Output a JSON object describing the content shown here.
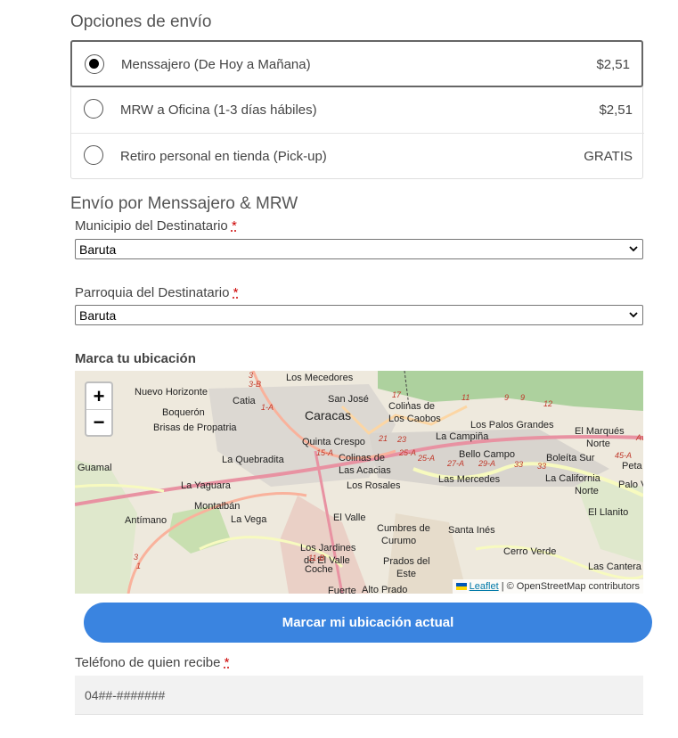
{
  "shipping": {
    "title": "Opciones de envío",
    "options": [
      {
        "label": "Menssajero (De Hoy a Mañana)",
        "price": "$2,51",
        "selected": true
      },
      {
        "label": "MRW a Oficina (1-3 días hábiles)",
        "price": "$2,51",
        "selected": false
      },
      {
        "label": "Retiro personal en tienda (Pick-up)",
        "price": "GRATIS",
        "selected": false
      }
    ]
  },
  "messenger": {
    "title": "Envío por Menssajero & MRW",
    "municipio": {
      "label": "Municipio del Destinatario",
      "required": "*",
      "value": "Baruta"
    },
    "parroquia": {
      "label": "Parroquia del Destinatario",
      "required": "*",
      "value": "Baruta"
    }
  },
  "map": {
    "label": "Marca tu ubicación",
    "zoom_in": "+",
    "zoom_out": "−",
    "attribution_link": "Leaflet",
    "attribution_text": "| © OpenStreetMap contributors",
    "places": [
      "Los Mecedores",
      "Nuevo Horizonte",
      "Catia",
      "San José",
      "Colinas de",
      "Los Caobos",
      "Boquerón",
      "Caracas",
      "Brisas de Propatria",
      "Los Palos Grandes",
      "El Marqués",
      "Norte",
      "Quinta Crespo",
      "La Campiña",
      "Bello Campo",
      "Boleíta Sur",
      "Guamal",
      "La Quebradita",
      "Colinas de",
      "Las Acacias",
      "Peta",
      "La Yaguara",
      "Los Rosales",
      "Las Mercedes",
      "La California",
      "Norte",
      "Palo V",
      "Montalbán",
      "Antímano",
      "La Vega",
      "El Valle",
      "El Llanito",
      "Cumbres de",
      "Curumo",
      "Santa Inés",
      "Los Jardines",
      "de El Valle",
      "Cerro Verde",
      "Coche",
      "Prados del",
      "Este",
      "Las Cantera",
      "Alto Prado",
      "Fuerte"
    ],
    "road_labels": [
      "3",
      "3-B",
      "1-A",
      "17",
      "11",
      "9",
      "9",
      "12",
      "Av",
      "21",
      "23",
      "15-A",
      "25-A",
      "25-A",
      "27-A",
      "29-A",
      "33",
      "33",
      "45-A",
      "3",
      "11-B",
      "1"
    ]
  },
  "locate_button": "Marcar mi ubicación actual",
  "phone": {
    "label": "Teléfono de quien recibe",
    "required": "*",
    "placeholder": "04##-#######"
  }
}
